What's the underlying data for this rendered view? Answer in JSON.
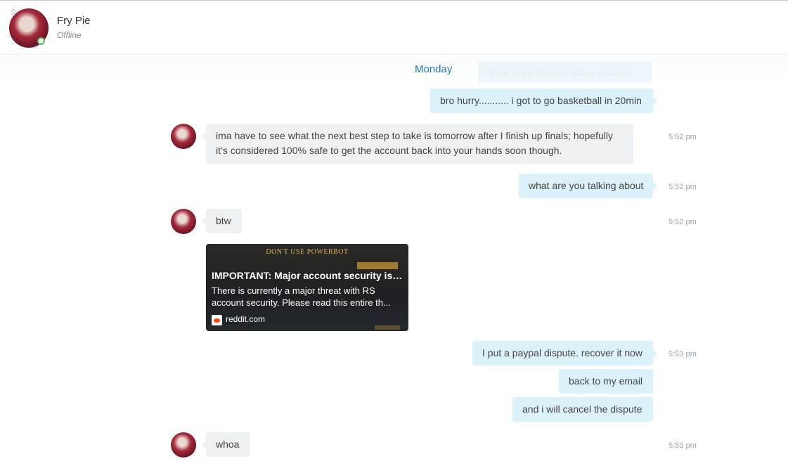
{
  "header": {
    "contact_name": "Fry Pie",
    "status": "Offline"
  },
  "day_separator": "Monday",
  "ghost_message": "i think jagex did it for safety reasons",
  "messages": [
    {
      "dir": "out",
      "text": "bro hurry........... i got to go basketball in 20min",
      "time": ""
    },
    {
      "dir": "in",
      "lines": [
        "ima have to see what the next best step to take is tomorrow after I finish up finals; hopefully",
        "it’s considered 100% safe to get the account back into your hands soon though."
      ],
      "time": "5:52 pm"
    },
    {
      "dir": "out",
      "text": "what are you talking about",
      "time": "5:52 pm"
    },
    {
      "dir": "in",
      "text": "btw",
      "time": "5:52 pm"
    },
    {
      "dir": "out",
      "text": "I put a paypal dispute. recover it now",
      "time": "5:53 pm"
    },
    {
      "dir": "out",
      "text": "back to my email",
      "time": ""
    },
    {
      "dir": "out",
      "text": "and i will cancel the dispute",
      "time": ""
    },
    {
      "dir": "in",
      "text": "whoa",
      "time": "5:53 pm"
    }
  ],
  "link_preview": {
    "banner": "DON'T USE POWERBOT",
    "title": "IMPORTANT: Major account security iss...",
    "desc_lines": [
      "There is currently a major threat with RS",
      "account security. Please read this entire th..."
    ],
    "domain": "reddit.com"
  },
  "colors": {
    "accent": "#1f7ab7",
    "outgoing_bubble": "#dcf2fb",
    "incoming_bubble": "#eef1f4",
    "online_ring": "#5cb85c"
  },
  "icons": {
    "favorite": "star-icon",
    "presence": "status-dot-icon",
    "link_source": "reddit-icon"
  }
}
